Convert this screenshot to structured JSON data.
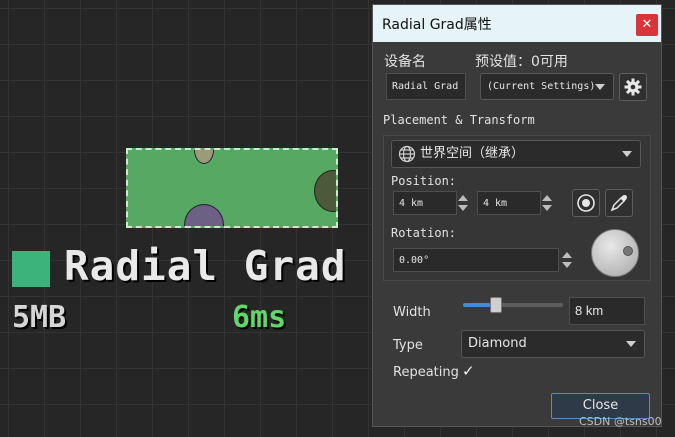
{
  "canvas": {
    "node_title": "Radial Grad",
    "node_size": "5MB",
    "node_time": "6ms",
    "swatch_color": "#3bb37a",
    "preview_color": "#57a863"
  },
  "dialog": {
    "title": "Radial Grad属性",
    "close_glyph": "✕",
    "device_name_label": "设备名",
    "device_name_value": "Radial Grad",
    "preset_label": "预设值：0可用",
    "preset_selected": "(Current Settings)",
    "preset_icon": "gear-icon",
    "placement_label": "Placement & Transform",
    "space_selected": "世界空间（继承）",
    "space_icon": "globe-icon",
    "position_label": "Position:",
    "position_x": "4 km",
    "position_y": "4 km",
    "target_icon": "target-icon",
    "pick_icon": "eyedropper-icon",
    "rotation_label": "Rotation:",
    "rotation_value": "0.00°",
    "width_label": "Width",
    "width_value": "8 km",
    "width_slider_fraction": 0.33,
    "type_label": "Type",
    "type_selected": "Diamond",
    "repeating_label": "Repeating",
    "repeating_check": "✓",
    "repeating_checked": true,
    "close_button_label": "Close",
    "accent_color": "#3f8bd6"
  },
  "watermark": "CSDN @tsns00"
}
